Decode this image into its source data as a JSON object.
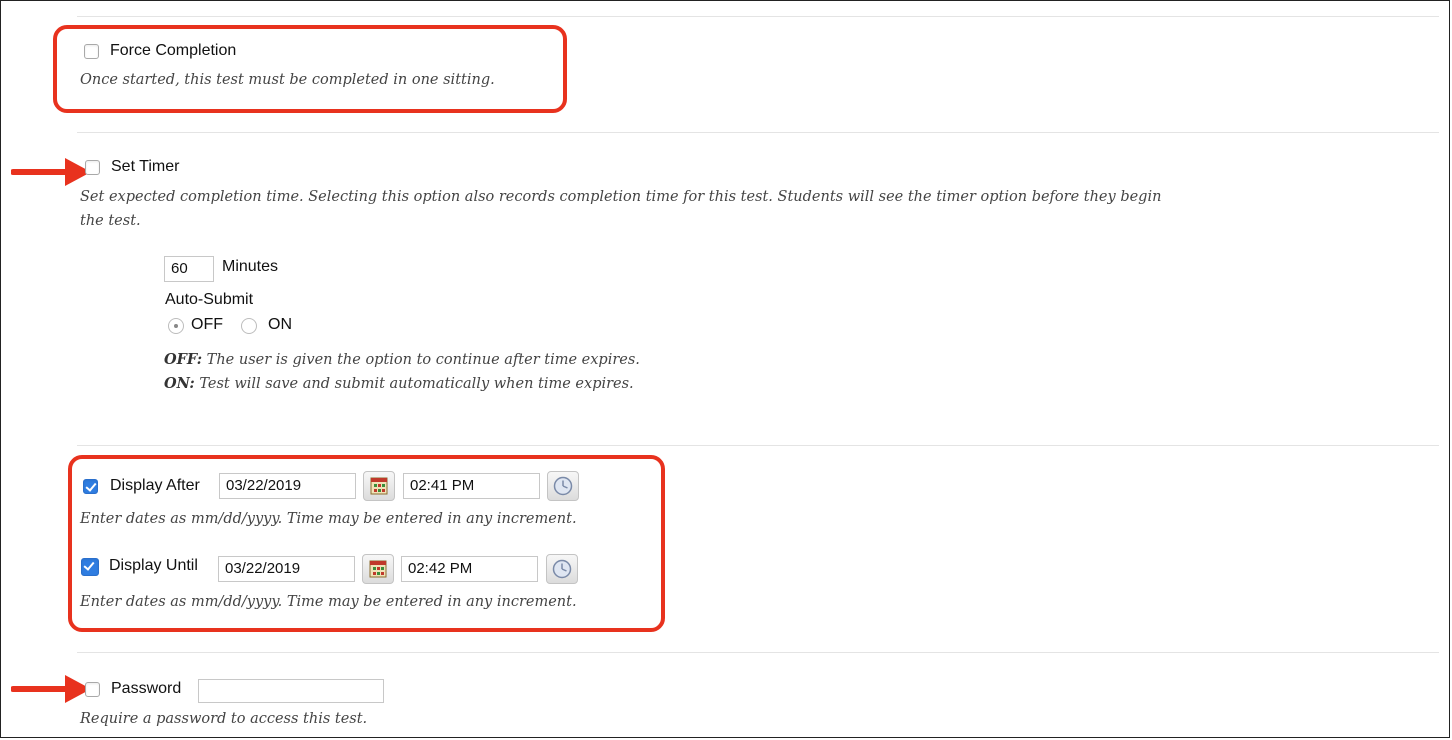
{
  "force_completion": {
    "label": "Force Completion",
    "checked": false,
    "help": "Once started, this test must be completed in one sitting."
  },
  "set_timer": {
    "label": "Set Timer",
    "checked": false,
    "help_line1": "Set expected completion time. Selecting this option also records completion time for this test. Students will see the timer option before they begin",
    "help_line2": "the test.",
    "minutes_value": "60",
    "minutes_label": "Minutes",
    "auto_submit_label": "Auto-Submit",
    "off_label": "OFF",
    "on_label": "ON",
    "selected_option": "OFF",
    "off_desc_key": "OFF:",
    "off_desc": " The user is given the option to continue after time expires.",
    "on_desc_key": "ON:",
    "on_desc": " Test will save and submit automatically when time expires."
  },
  "display_after": {
    "label": "Display After",
    "checked": true,
    "date": "03/22/2019",
    "time": "02:41 PM",
    "help": "Enter dates as mm/dd/yyyy. Time may be entered in any increment."
  },
  "display_until": {
    "label": "Display Until",
    "checked": true,
    "date": "03/22/2019",
    "time": "02:42 PM",
    "help": "Enter dates as mm/dd/yyyy. Time may be entered in any increment."
  },
  "password": {
    "label": "Password",
    "checked": false,
    "value": "",
    "help": "Require a password to access this test."
  },
  "colors": {
    "highlight": "#e8321e",
    "checkbox_checked": "#2f7de1"
  },
  "icons": {
    "date_picker": "calendar-icon",
    "time_picker": "clock-icon",
    "annotation": "arrow-right-icon"
  }
}
